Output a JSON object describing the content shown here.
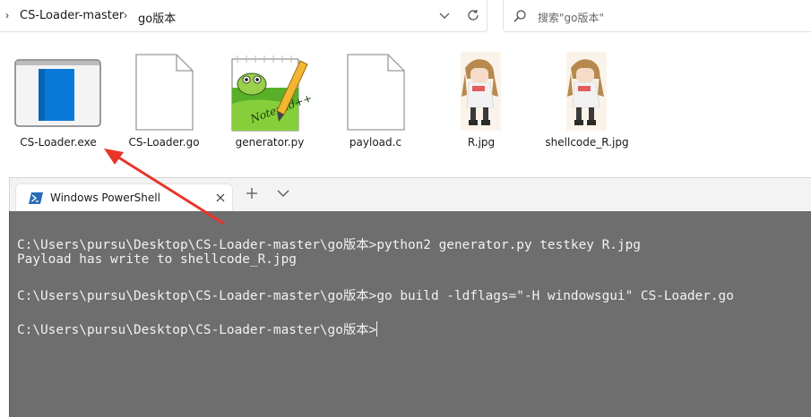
{
  "explorer": {
    "breadcrumb": [
      "CS-Loader-master",
      "go版本"
    ],
    "search_placeholder": "搜索\"go版本\"",
    "files": [
      {
        "name": "CS-Loader.exe",
        "icon": "exe-icon"
      },
      {
        "name": "CS-Loader.go",
        "icon": "blank-file-icon"
      },
      {
        "name": "generator.py",
        "icon": "notepadpp-icon"
      },
      {
        "name": "payload.c",
        "icon": "blank-file-icon"
      },
      {
        "name": "R.jpg",
        "icon": "image-thumbnail"
      },
      {
        "name": "shellcode_R.jpg",
        "icon": "image-thumbnail"
      }
    ]
  },
  "terminal": {
    "tab_title": "Windows PowerShell",
    "lines": [
      "C:\\Users\\pursu\\Desktop\\CS-Loader-master\\go版本>python2 generator.py testkey R.jpg",
      "Payload has write to shellcode_R.jpg",
      "",
      "C:\\Users\\pursu\\Desktop\\CS-Loader-master\\go版本>go build -ldflags=\"-H windowsgui\" CS-Loader.go",
      "",
      "C:\\Users\\pursu\\Desktop\\CS-Loader-master\\go版本>"
    ]
  },
  "annotation": {
    "arrow_color": "#e8352a"
  }
}
